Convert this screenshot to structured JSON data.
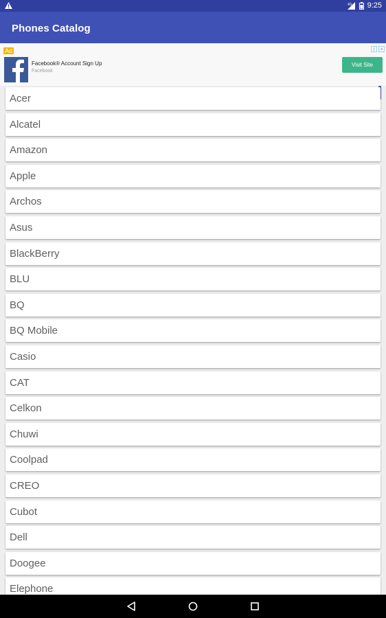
{
  "status_bar": {
    "time": "9:25",
    "signal": "4G"
  },
  "app_bar": {
    "title": "Phones Catalog"
  },
  "ad": {
    "badge": "Ad",
    "title": "Facebook® Account Sign Up",
    "advertiser": "Facebook",
    "button_label": "Visit Site",
    "button_color": "#3db58a"
  },
  "colors": {
    "primary": "#3f51b5",
    "primary_dark": "#303f9f",
    "background": "#eeeeee"
  },
  "brands": [
    {
      "label": "Acer"
    },
    {
      "label": "Alcatel"
    },
    {
      "label": "Amazon"
    },
    {
      "label": "Apple"
    },
    {
      "label": "Archos"
    },
    {
      "label": "Asus"
    },
    {
      "label": "BlackBerry"
    },
    {
      "label": "BLU"
    },
    {
      "label": "BQ"
    },
    {
      "label": "BQ Mobile"
    },
    {
      "label": "Casio"
    },
    {
      "label": "CAT"
    },
    {
      "label": "Celkon"
    },
    {
      "label": "Chuwi"
    },
    {
      "label": "Coolpad"
    },
    {
      "label": "CREO"
    },
    {
      "label": "Cubot"
    },
    {
      "label": "Dell"
    },
    {
      "label": "Doogee"
    },
    {
      "label": "Elephone"
    }
  ],
  "icons": {
    "status_left": "warning-icon",
    "nav": [
      "back-icon",
      "home-icon",
      "recents-icon"
    ]
  }
}
